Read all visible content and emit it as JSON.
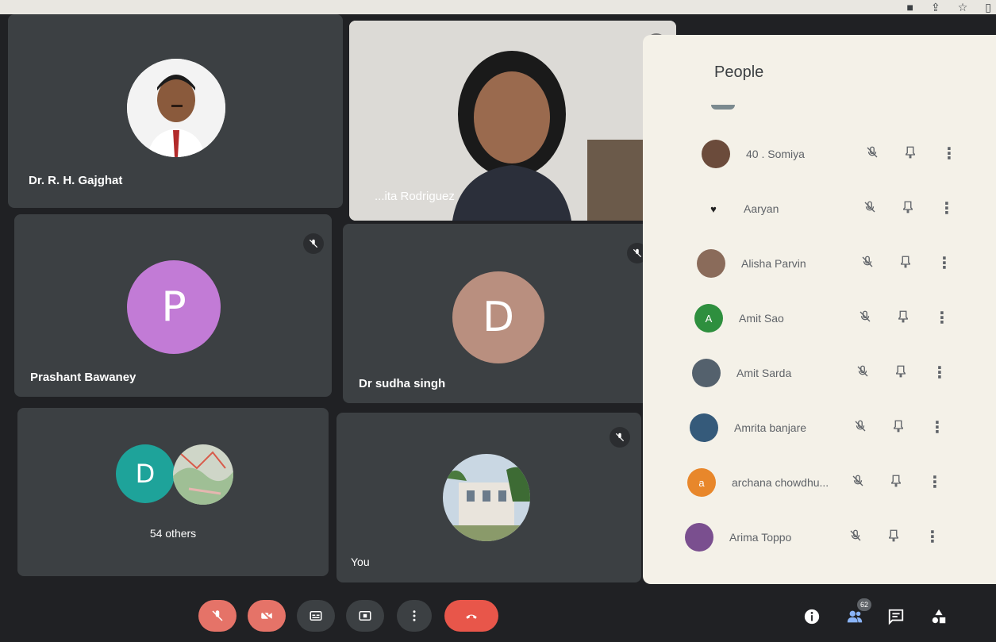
{
  "browser": {
    "icons": [
      "camera-icon",
      "share-icon",
      "star-icon",
      "window-icon"
    ]
  },
  "tiles": {
    "t1": {
      "name": "Dr. R. H. Gajghat"
    },
    "t2": {
      "name": "...ita Rodriguez"
    },
    "t3": {
      "name": "Prashant Bawaney",
      "initial": "P",
      "color": "#c27bd6"
    },
    "t4": {
      "name": "Dr sudha singh",
      "initial": "D",
      "color": "#b98f7f"
    },
    "t5": {
      "initial": "D",
      "label": "54 others",
      "color": "#1ea39a"
    },
    "t6": {
      "name": "You"
    }
  },
  "controls": {
    "mic": {
      "icon": "mic-off-icon",
      "color": "#e57368"
    },
    "camera": {
      "icon": "camera-off-icon",
      "color": "#e57368"
    },
    "captions": {
      "icon": "captions-icon"
    },
    "present": {
      "icon": "present-icon"
    },
    "more": {
      "icon": "more-options-icon"
    },
    "leave": {
      "icon": "hang-up-icon",
      "color": "#e8564a"
    },
    "info": {
      "icon": "info-icon"
    },
    "people": {
      "icon": "people-icon",
      "count": "62"
    },
    "chat": {
      "icon": "chat-icon"
    },
    "activities": {
      "icon": "activities-icon"
    }
  },
  "panel": {
    "title": "People",
    "participants": [
      {
        "name": "40 . Somiya",
        "initial": "",
        "color": "#6b4b3b"
      },
      {
        "name": "Aaryan",
        "initial": "♥",
        "color": "#f4f1e8"
      },
      {
        "name": "Alisha Parvin",
        "initial": "",
        "color": "#8a6b5a"
      },
      {
        "name": "Amit Sao",
        "initial": "A",
        "color": "#2e8f3e"
      },
      {
        "name": "Amit Sarda",
        "initial": "",
        "color": "#54616d"
      },
      {
        "name": "Amrita banjare",
        "initial": "",
        "color": "#355a7a"
      },
      {
        "name": "archana chowdhu...",
        "initial": "a",
        "color": "#e8872b"
      },
      {
        "name": "Arima Toppo",
        "initial": "",
        "color": "#7a4f8f"
      }
    ]
  }
}
